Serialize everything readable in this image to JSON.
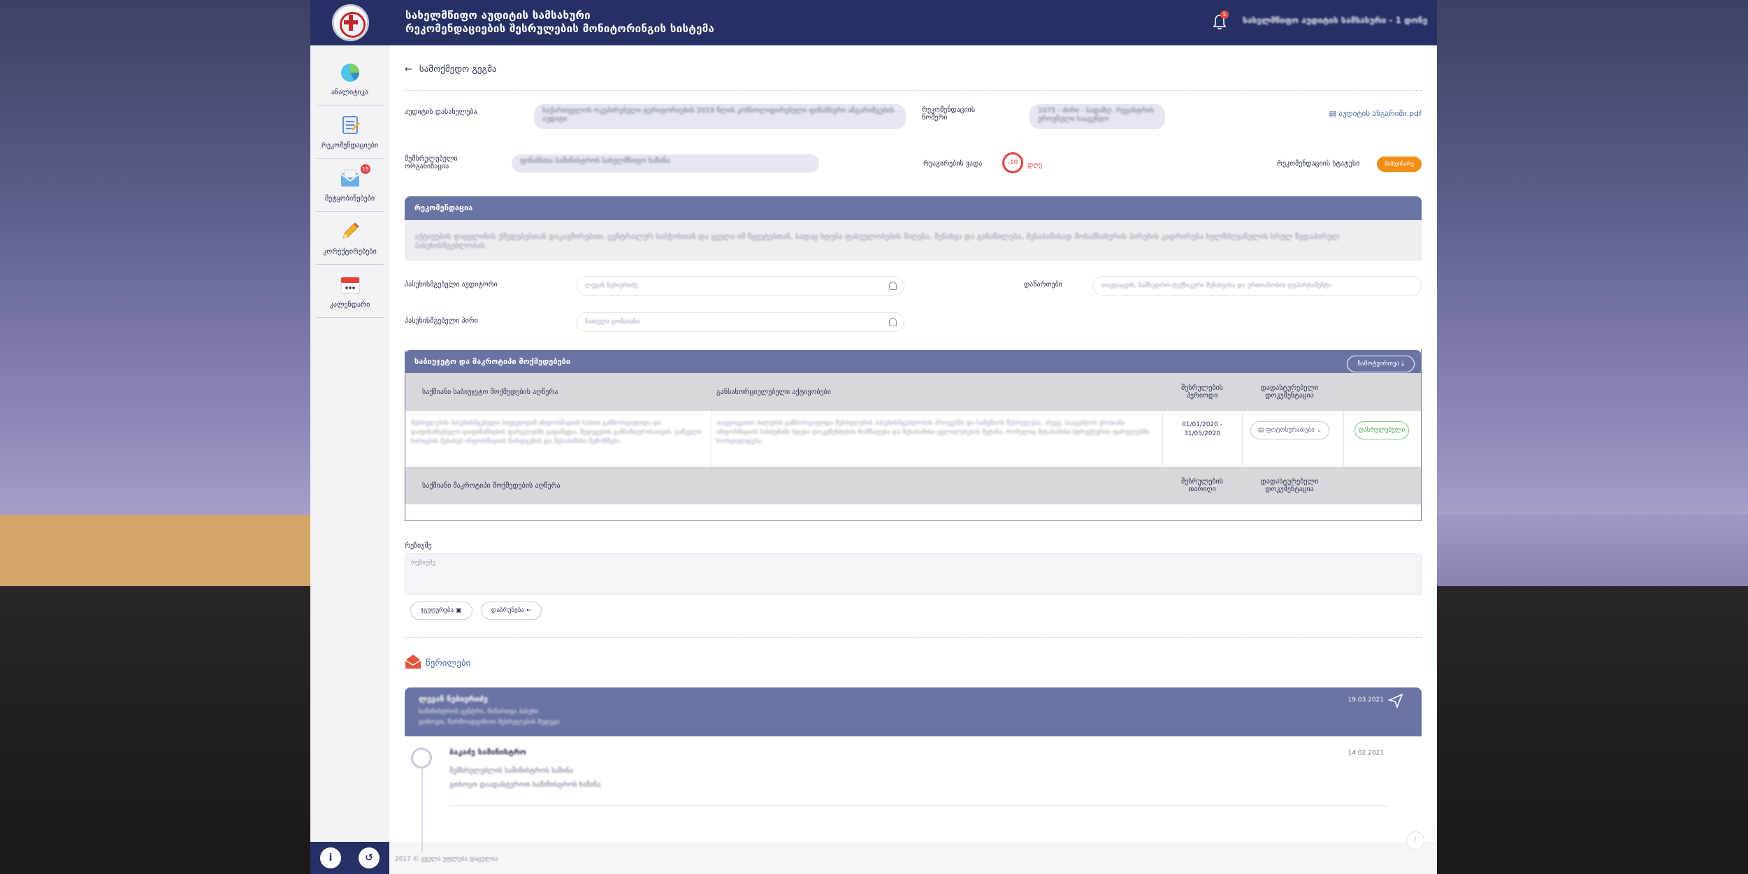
{
  "header": {
    "title_line1": "სახელმწიფო აუდიტის სამსახური",
    "title_line2": "რეკომენდაციების შესრულების მონიტორინგის სისტემა",
    "notification_count": "5",
    "user_name": "სახელმწიფო აუდიტის სამსახური - 1 დონე"
  },
  "sidebar": {
    "items": [
      {
        "label": "ანალიტიკა",
        "icon": "analytics-pie-icon",
        "badge": ""
      },
      {
        "label": "რეკომენდაციები",
        "icon": "recommendations-doc-icon",
        "badge": ""
      },
      {
        "label": "შეტყობინებები",
        "icon": "messages-mail-icon",
        "badge": "19"
      },
      {
        "label": "კორექტირებები",
        "icon": "pencil-icon",
        "badge": ""
      },
      {
        "label": "კალენდარი",
        "icon": "calendar-icon",
        "badge": ""
      }
    ],
    "bottom_info": "i",
    "bottom_logout": "↺"
  },
  "main": {
    "back_label": "სამოქმედო გეგმა",
    "audit_name_label": "აუდიტის დასახელება",
    "audit_name_value": "საქართველოს ოკუპირებული ტერიტორიების 2019 წლის კონსოლიდირებული ფინანსური ანგარიშგების აუდიტი",
    "rec_number_label": "რეკომენდაციის ნომერი",
    "rec_number_value": "1075 - ძირი - სადაზღ. რეგისტრის ეროვნული სააგენტო",
    "pdf_label": "აუდიტის ანგარიში.pdf",
    "responsible_org_label": "შემსრულებელი ორგანიზაცია",
    "responsible_org_value": "ფინანსთა სამინისტროს სახელმწიფო ხაზინა",
    "deadline_label": "რეაგირების ვადა",
    "deadline_days": "-10",
    "deadline_unit": "დღე",
    "status_label": "რეკომენდაციის სტატუსი",
    "status_value": "მიმდინარე",
    "status_color": "#f08e18",
    "recommendation_header": "რეკომენდაცია",
    "recommendation_text": "აქტივების დაყვლინის ქმედებებთან დაკავშირებით, ცენტრალურ საბჭოსთან და ყველა იმ წყვეტებთან, სადაც ხდება ფასეულობების მიღება, შენახვა და განაწილება, შესაბამისად მოსამსახურის პირების კადრირება ხელმძღვანელის სრულ ზედაპირულ პასუხისმგებლობას.",
    "responsible_auditor_label": "პასუხისმგებელი აუდიტორი",
    "responsible_auditor_value": "ლევან ნებიერიძე",
    "responsible_person_label": "პასუხისმგებელი პირი",
    "responsible_person_value": "ნათელა ცომაიანი",
    "attachments_label": "დანართები",
    "attachments_value": "თავდაცვის, სამხედრო-ტექნიკური შენახვისა და ერთიანობის დეპარტამენტი",
    "table_panel_title": "საბიუჯეტო და მაკროტიპი მოქმედებები",
    "export_label": "ჩამოტვირთვა",
    "table_headers": {
      "col1": "საქმიანი საბიუჯეტო მოქმედების აღწერა",
      "col2": "განსახორციელებელი აქტივობები",
      "col3": "შესრულების პერიოდი",
      "col4": "დადასტურებელი დოკუმენტაცია"
    },
    "table_row": {
      "col1": "შესრულების პასუხისმგებელი ბიუჯეტიდან ინფორმაციის სახით განხორციელდა და დაფინანსებული დაფინანსების ფარგლებში გადაწყდა, შედეგების განსაზღვრისათვის, გაწეული ხარჯების შესახებ ინფორმაციის წარდგენის და შესაბამისი შემოწმება.",
      "col2": "თავდაცვითი ძალების განხორციელდა შესრულების პასუხისმგებლობის პროცესში და სამუშაოს შესრულება, ასევე, სააგენტოს ერთიანი ინფორმაციის სისტემაში ხდება დოკუმენტების მომზადება და შესაბამისი ცვლილებების შეტანა, რომელიც შესაბამისი სტრუქტურის ფარგლებში ხორციელდება.",
      "period": "01/01/2020 - 31/05/2020",
      "doc_chip": "ფოტოსურათები",
      "status_chip": "დასრულებული"
    },
    "table_headers2": {
      "col1": "საქმიანი მაკროტიპი მოქმედების აღწერა",
      "col3": "შესრულების თარიღი",
      "col4": "დადასტურებელი დოკუმენტაცია"
    },
    "comment_label": "რეზიუმე",
    "comment_placeholder": "რეზიუმე",
    "button_send": "ჯგუფურება",
    "button_back": "დაბრუნება",
    "letters_title": "წერილები"
  },
  "messages": {
    "main": {
      "sender": "ლევან ნებიერიძე",
      "line1": "სამინისტროს ცენტრი, მიმართვა პასუხი",
      "line2": "გთხოვთ, წარმოადგინოთ შესრულების შედეგი",
      "date": "19.03.2021"
    },
    "reply": {
      "sender": "ბაკაძე სამინისტრო",
      "line1": "შემსრულებლის სამინისტროს ხაზინა",
      "line2": "გთხოვთ დაადასტუროთ სამინისტროს ხაზინა",
      "date": "14.02.2021"
    }
  },
  "footer": {
    "text": "2017 © ყველა უფლება დაცულია"
  }
}
